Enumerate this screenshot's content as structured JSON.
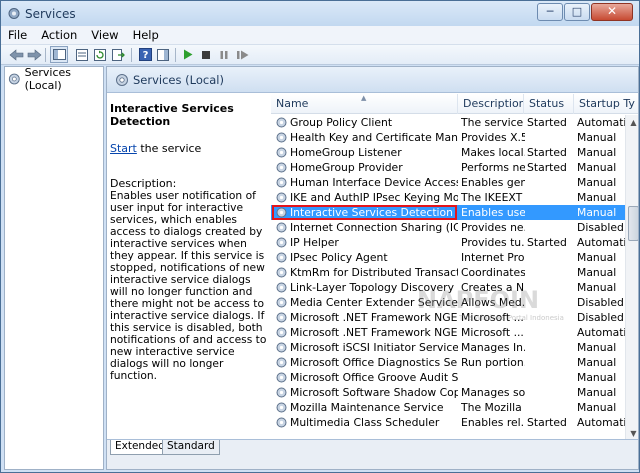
{
  "window": {
    "title": "Services"
  },
  "menu": [
    "File",
    "Action",
    "View",
    "Help"
  ],
  "tree": {
    "item": "Services (Local)"
  },
  "pane_header": "Services (Local)",
  "detail": {
    "title": "Interactive Services Detection",
    "start_link": "Start",
    "start_suffix": " the service",
    "desc_label": "Description:",
    "desc_text": "Enables user notification of user input for interactive services, which enables access to dialogs created by interactive services when they appear. If this service is stopped, notifications of new interactive service dialogs will no longer function and there might not be access to interactive service dialogs. If this service is disabled, both notifications of and access to new interactive service dialogs will no longer function."
  },
  "columns": [
    "Name",
    "Description",
    "Status",
    "Startup Ty"
  ],
  "services": [
    {
      "name": "Group Policy Client",
      "description": "The service ...",
      "status": "Started",
      "startup": "Automatic"
    },
    {
      "name": "Health Key and Certificate Management",
      "description": "Provides X.5...",
      "status": "",
      "startup": "Manual"
    },
    {
      "name": "HomeGroup Listener",
      "description": "Makes local...",
      "status": "Started",
      "startup": "Manual"
    },
    {
      "name": "HomeGroup Provider",
      "description": "Performs ne...",
      "status": "Started",
      "startup": "Manual"
    },
    {
      "name": "Human Interface Device Access",
      "description": "Enables gen...",
      "status": "",
      "startup": "Manual"
    },
    {
      "name": "IKE and AuthIP IPsec Keying Modules",
      "description": "The IKEEXT ...",
      "status": "",
      "startup": "Manual"
    },
    {
      "name": "Interactive Services Detection",
      "description": "Enables use...",
      "status": "",
      "startup": "Manual",
      "selected": true
    },
    {
      "name": "Internet Connection Sharing (ICS)",
      "description": "Provides ne...",
      "status": "",
      "startup": "Disabled"
    },
    {
      "name": "IP Helper",
      "description": "Provides tu...",
      "status": "Started",
      "startup": "Automatic"
    },
    {
      "name": "IPsec Policy Agent",
      "description": "Internet Pro...",
      "status": "",
      "startup": "Manual"
    },
    {
      "name": "KtmRm for Distributed Transaction Co...",
      "description": "Coordinates...",
      "status": "",
      "startup": "Manual"
    },
    {
      "name": "Link-Layer Topology Discovery Mapper",
      "description": "Creates a N...",
      "status": "",
      "startup": "Manual"
    },
    {
      "name": "Media Center Extender Service",
      "description": "Allows Med...",
      "status": "",
      "startup": "Disabled"
    },
    {
      "name": "Microsoft .NET Framework NGEN v2.0....",
      "description": "Microsoft ....",
      "status": "",
      "startup": "Disabled"
    },
    {
      "name": "Microsoft .NET Framework NGEN v4.0....",
      "description": "Microsoft ....",
      "status": "",
      "startup": "Automatic"
    },
    {
      "name": "Microsoft iSCSI Initiator Service",
      "description": "Manages In...",
      "status": "",
      "startup": "Manual"
    },
    {
      "name": "Microsoft Office Diagnostics Service",
      "description": "Run portion...",
      "status": "",
      "startup": "Manual"
    },
    {
      "name": "Microsoft Office Groove Audit Service",
      "description": "",
      "status": "",
      "startup": "Manual"
    },
    {
      "name": "Microsoft Software Shadow Copy Prov...",
      "description": "Manages so...",
      "status": "",
      "startup": "Manual"
    },
    {
      "name": "Mozilla Maintenance Service",
      "description": "The Mozilla ...",
      "status": "",
      "startup": "Manual"
    },
    {
      "name": "Multimedia Class Scheduler",
      "description": "Enables rel...",
      "status": "Started",
      "startup": "Automatic"
    }
  ],
  "tabs": [
    "Extended",
    "Standard"
  ],
  "watermark": {
    "text": "NAPFOIN",
    "sub": "The Windows Portal Indonesia"
  },
  "colors": {
    "selection": "#3399ff",
    "highlight_border": "#e3141b",
    "link": "#0645ad"
  }
}
